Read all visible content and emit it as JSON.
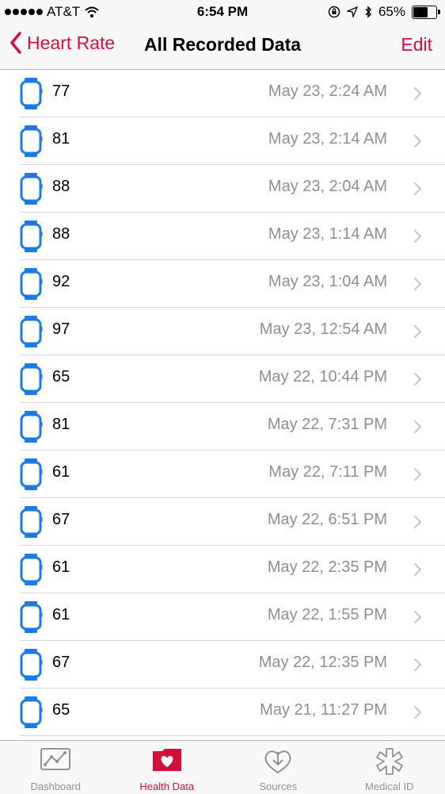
{
  "status_bar": {
    "carrier": "AT&T",
    "time": "6:54 PM",
    "battery_percent": "65%",
    "battery_level": 0.65
  },
  "nav": {
    "back_label": "Heart Rate",
    "title": "All Recorded Data",
    "edit_label": "Edit"
  },
  "accent_color": "#d0103a",
  "records": [
    {
      "value": "77",
      "date": "May 23, 2:24 AM"
    },
    {
      "value": "81",
      "date": "May 23, 2:14 AM"
    },
    {
      "value": "88",
      "date": "May 23, 2:04 AM"
    },
    {
      "value": "88",
      "date": "May 23, 1:14 AM"
    },
    {
      "value": "92",
      "date": "May 23, 1:04 AM"
    },
    {
      "value": "97",
      "date": "May 23, 12:54 AM"
    },
    {
      "value": "65",
      "date": "May 22, 10:44 PM"
    },
    {
      "value": "81",
      "date": "May 22, 7:31 PM"
    },
    {
      "value": "61",
      "date": "May 22, 7:11 PM"
    },
    {
      "value": "67",
      "date": "May 22, 6:51 PM"
    },
    {
      "value": "61",
      "date": "May 22, 2:35 PM"
    },
    {
      "value": "61",
      "date": "May 22, 1:55 PM"
    },
    {
      "value": "67",
      "date": "May 22, 12:35 PM"
    },
    {
      "value": "65",
      "date": "May 21, 11:27 PM"
    }
  ],
  "tabs": [
    {
      "label": "Dashboard",
      "icon": "dashboard-icon",
      "active": false
    },
    {
      "label": "Health Data",
      "icon": "health-data-icon",
      "active": true
    },
    {
      "label": "Sources",
      "icon": "sources-icon",
      "active": false
    },
    {
      "label": "Medical ID",
      "icon": "medical-id-icon",
      "active": false
    }
  ]
}
